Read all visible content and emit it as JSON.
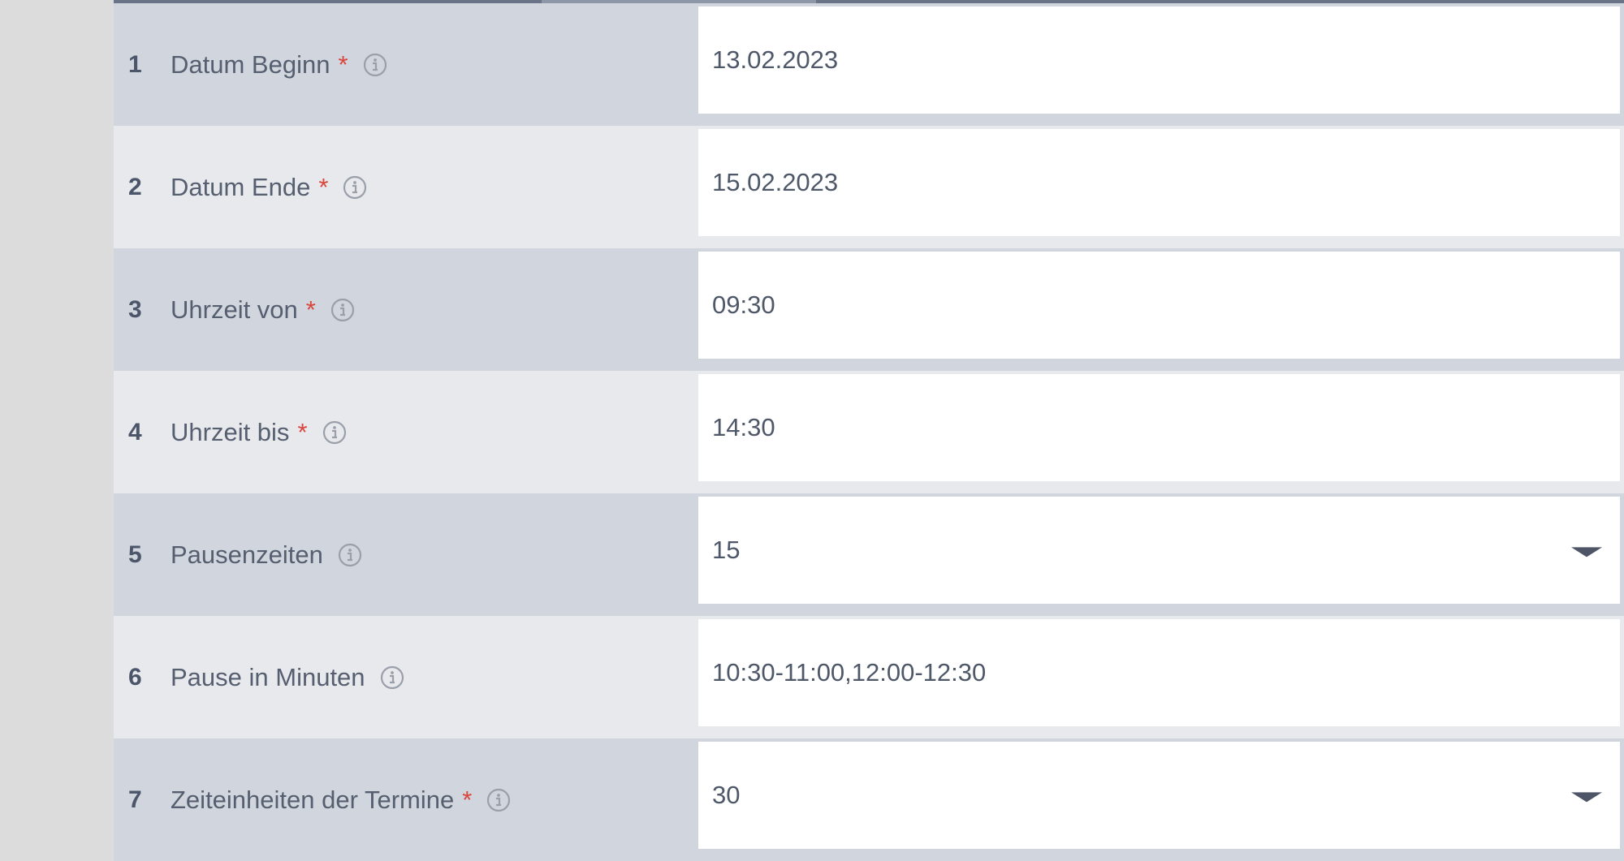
{
  "form": {
    "rows": [
      {
        "num": "1",
        "label": "Datum Beginn",
        "required": "*",
        "value": "13.02.2023",
        "type": "date"
      },
      {
        "num": "2",
        "label": "Datum Ende",
        "required": "*",
        "value": "15.02.2023",
        "type": "date"
      },
      {
        "num": "3",
        "label": "Uhrzeit von",
        "required": "*",
        "value": "09:30",
        "type": "time"
      },
      {
        "num": "4",
        "label": "Uhrzeit bis",
        "required": "*",
        "value": "14:30",
        "type": "time"
      },
      {
        "num": "5",
        "label": "Pausenzeiten",
        "required": "",
        "value": "15",
        "type": "select"
      },
      {
        "num": "6",
        "label": "Pause in Minuten",
        "required": "",
        "value": "10:30-11:00,12:00-12:30",
        "type": "text"
      },
      {
        "num": "7",
        "label": "Zeiteinheiten der Termine",
        "required": "*",
        "value": "30",
        "type": "select"
      }
    ]
  },
  "icons": {
    "info": "info-circle-icon",
    "dropdown": "chevron-down-icon"
  },
  "colors": {
    "required_marker": "#d9453b",
    "row_dark": "#d1d5dd",
    "row_light": "#e8e9ed",
    "top_bar": "#6a7489"
  }
}
